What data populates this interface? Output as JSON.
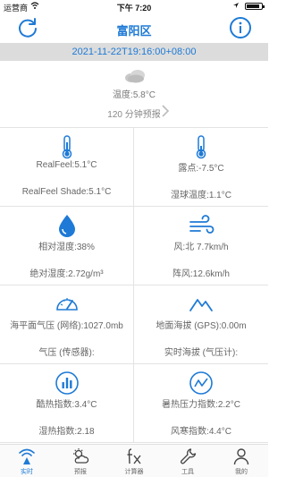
{
  "status_bar": {
    "carrier": "运营商",
    "time": "下午 7:20",
    "battery_level": 0.9
  },
  "header": {
    "title": "富阳区"
  },
  "date_bar": {
    "text": "2021-11-22T19:16:00+08:00"
  },
  "current": {
    "temperature": "温度:5.8°C",
    "forecast_link": "120 分钟预报"
  },
  "cells": [
    {
      "line1": "RealFeel:5.1°C",
      "line2": "RealFeel Shade:5.1°C"
    },
    {
      "line1": "露点:-7.5°C",
      "line2": "湿球温度:1.1°C"
    },
    {
      "line1": "相对湿度:38%",
      "line2": "绝对湿度:2.72g/m³"
    },
    {
      "line1": "风:北 7.7km/h",
      "line2": "阵风:12.6km/h"
    },
    {
      "line1": "海平面气压 (网络):1027.0mb",
      "line2": "气压 (传感器):"
    },
    {
      "line1": "地面海拔 (GPS):0.00m",
      "line2": "实时海拔 (气压计):"
    },
    {
      "line1": "酷热指数:3.4°C",
      "line2": "湿热指数:2.18"
    },
    {
      "line1": "暑热压力指数:2.2°C",
      "line2": "风寒指数:4.4°C"
    }
  ],
  "tabs": [
    {
      "label": "实时",
      "icon": "realtime-icon",
      "active": true
    },
    {
      "label": "预报",
      "icon": "forecast-icon",
      "active": false
    },
    {
      "label": "计算器",
      "icon": "calculator-icon",
      "active": false
    },
    {
      "label": "工具",
      "icon": "wrench-icon",
      "active": false
    },
    {
      "label": "我的",
      "icon": "person-icon",
      "active": false
    }
  ],
  "colors": {
    "accent": "#1e7ad6",
    "date_bar_bg": "#dcdcdc"
  }
}
